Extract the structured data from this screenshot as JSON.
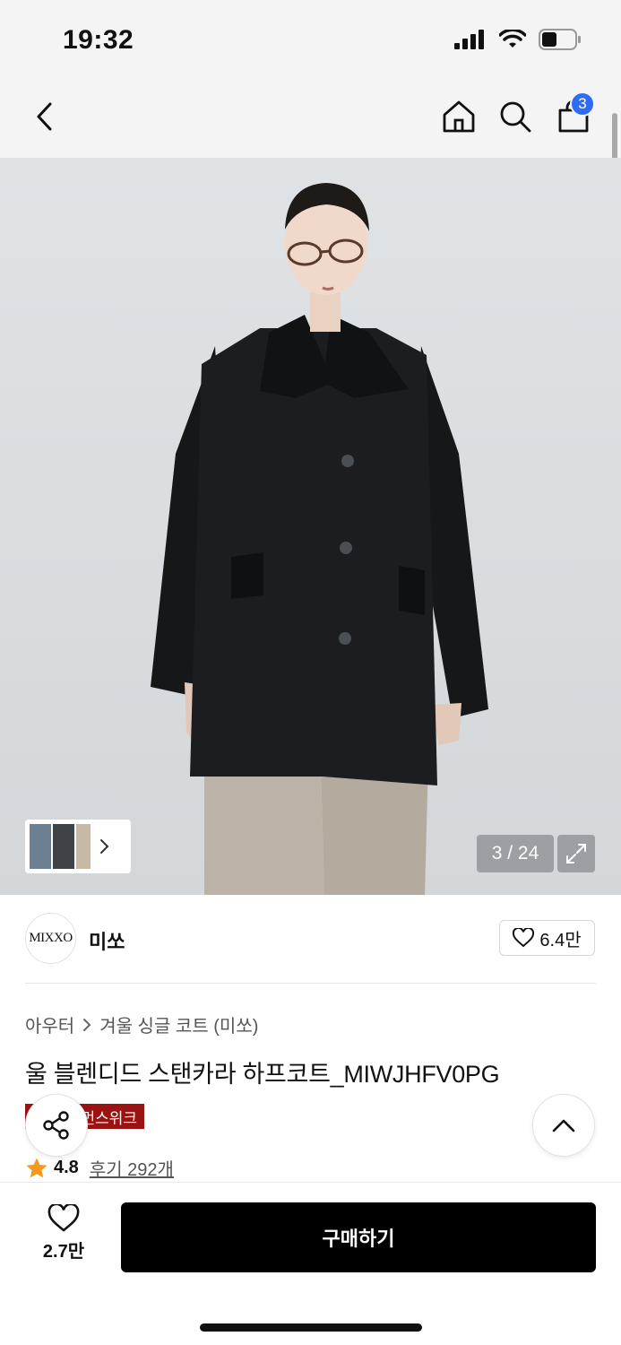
{
  "status_bar": {
    "time": "19:32"
  },
  "header": {
    "cart_count": "3"
  },
  "gallery": {
    "counter": "3 / 24"
  },
  "brand": {
    "logo_text": "MIXXO",
    "name": "미쏘",
    "like_count": "6.4만"
  },
  "product": {
    "breadcrumb": [
      "아우터",
      "겨울 싱글 코트 (미쏘)"
    ],
    "title": "울 블렌디드 스탠카라 하프코트_MIWJHFV0PG",
    "event_badge": "먼스위크",
    "rating": "4.8",
    "review_label": "후기 292개"
  },
  "bottom": {
    "wish_count": "2.7만",
    "buy_label": "구매하기"
  },
  "colors": {
    "accent_blue": "#2f6cf5",
    "event_red": "#9b1212",
    "star": "#f29a1a",
    "buy_bg": "#000000"
  }
}
